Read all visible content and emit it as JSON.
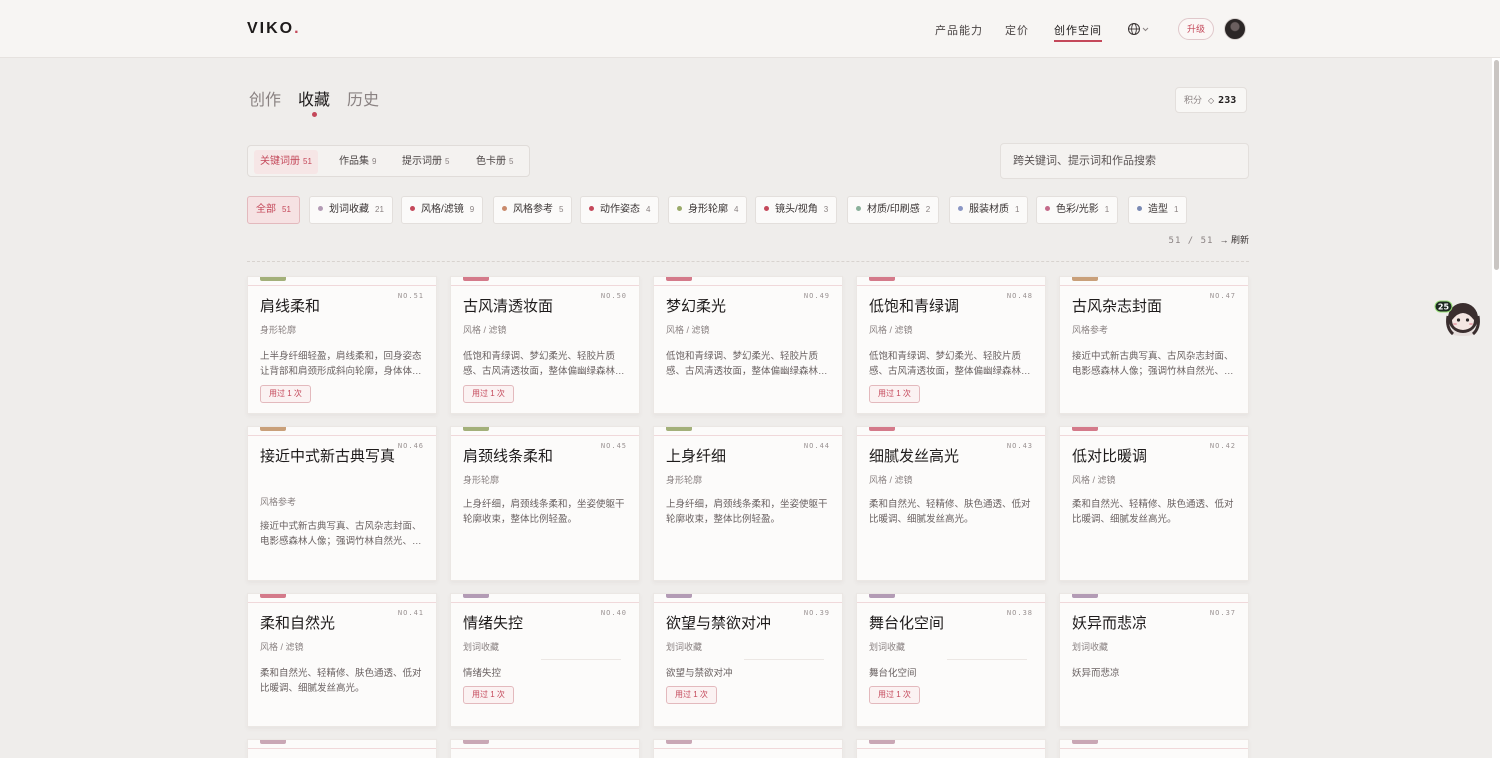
{
  "brand": {
    "name": "VIKO",
    "dot": "."
  },
  "nav": {
    "items": [
      "产品能力",
      "定价",
      "创作空间"
    ],
    "active_index": 2,
    "upgrade_label": "升级",
    "globe_icon": "globe-icon"
  },
  "main_tabs": {
    "items": [
      "创作",
      "收藏",
      "历史"
    ],
    "active_index": 1
  },
  "points": {
    "label": "积分",
    "value": "233"
  },
  "sub_tabs": [
    {
      "label": "关键词册",
      "count": "51",
      "active": true
    },
    {
      "label": "作品集",
      "count": "9",
      "active": false
    },
    {
      "label": "提示词册",
      "count": "5",
      "active": false
    },
    {
      "label": "色卡册",
      "count": "5",
      "active": false
    }
  ],
  "search": {
    "placeholder": "跨关键词、提示词和作品搜索"
  },
  "filters": [
    {
      "label": "全部",
      "count": "51",
      "color": "",
      "active": true
    },
    {
      "label": "划词收藏",
      "count": "21",
      "color": "#b39bb5",
      "active": false
    },
    {
      "label": "风格/滤镜",
      "count": "9",
      "color": "#c4485a",
      "active": false
    },
    {
      "label": "风格参考",
      "count": "5",
      "color": "#c98a6c",
      "active": false
    },
    {
      "label": "动作姿态",
      "count": "4",
      "color": "#c4485a",
      "active": false
    },
    {
      "label": "身形轮廓",
      "count": "4",
      "color": "#9aaa6a",
      "active": false
    },
    {
      "label": "镜头/视角",
      "count": "3",
      "color": "#c4485a",
      "active": false
    },
    {
      "label": "材质/印刷感",
      "count": "2",
      "color": "#8ab09a",
      "active": false
    },
    {
      "label": "服装材质",
      "count": "1",
      "color": "#8a96c4",
      "active": false
    },
    {
      "label": "色彩/光影",
      "count": "1",
      "color": "#c46a8a",
      "active": false
    },
    {
      "label": "造型",
      "count": "1",
      "color": "#7a8ab4",
      "active": false
    }
  ],
  "result_count": {
    "text": "51 / 51",
    "refresh_label": "→ 刷新"
  },
  "cards": [
    {
      "no": "NO.51",
      "title": "肩线柔和",
      "category": "身形轮廓",
      "desc": "上半身纤细轻盈，肩线柔和，回身姿态让背部和肩颈形成斜向轮廓，身体体…",
      "used": "用过 1 次",
      "tag_color": "#a3b07a"
    },
    {
      "no": "NO.50",
      "title": "古风清透妆面",
      "category": "风格 / 滤镜",
      "desc": "低饱和青绿调、梦幻柔光、轻胶片质感、古风清透妆面，整体偏幽绿森林…",
      "used": "用过 1 次",
      "tag_color": "#d47a8a"
    },
    {
      "no": "NO.49",
      "title": "梦幻柔光",
      "category": "风格 / 滤镜",
      "desc": "低饱和青绿调、梦幻柔光、轻胶片质感、古风清透妆面，整体偏幽绿森林…",
      "used": "",
      "tag_color": "#d47a8a"
    },
    {
      "no": "NO.48",
      "title": "低饱和青绿调",
      "category": "风格 / 滤镜",
      "desc": "低饱和青绿调、梦幻柔光、轻胶片质感、古风清透妆面，整体偏幽绿森林…",
      "used": "用过 1 次",
      "tag_color": "#d47a8a"
    },
    {
      "no": "NO.47",
      "title": "古风杂志封面",
      "category": "风格参考",
      "desc": "接近中式新古典写真、古风杂志封面、电影感森林人像；强调竹林自然光、…",
      "used": "",
      "tag_color": "#c9a07a"
    },
    {
      "no": "NO.46",
      "title": "接近中式新古典写真",
      "category": "风格参考",
      "desc": "接近中式新古典写真、古风杂志封面、电影感森林人像；强调竹林自然光、…",
      "used": "",
      "tag_color": "#c9a07a"
    },
    {
      "no": "NO.45",
      "title": "肩颈线条柔和",
      "category": "身形轮廓",
      "desc": "上身纤细，肩颈线条柔和，坐姿使躯干轮廓收束，整体比例轻盈。",
      "used": "",
      "tag_color": "#a3b07a"
    },
    {
      "no": "NO.44",
      "title": "上身纤细",
      "category": "身形轮廓",
      "desc": "上身纤细，肩颈线条柔和，坐姿使躯干轮廓收束，整体比例轻盈。",
      "used": "",
      "tag_color": "#a3b07a"
    },
    {
      "no": "NO.43",
      "title": "细腻发丝高光",
      "category": "风格 / 滤镜",
      "desc": "柔和自然光、轻精修、肤色通透、低对比暖调、细腻发丝高光。",
      "used": "",
      "tag_color": "#d47a8a"
    },
    {
      "no": "NO.42",
      "title": "低对比暖调",
      "category": "风格 / 滤镜",
      "desc": "柔和自然光、轻精修、肤色通透、低对比暖调、细腻发丝高光。",
      "used": "",
      "tag_color": "#d47a8a"
    },
    {
      "no": "NO.41",
      "title": "柔和自然光",
      "category": "风格 / 滤镜",
      "desc": "柔和自然光、轻精修、肤色通透、低对比暖调、细腻发丝高光。",
      "used": "",
      "tag_color": "#d47a8a"
    },
    {
      "no": "NO.40",
      "title": "情绪失控",
      "category": "划词收藏",
      "desc": "情绪失控",
      "used": "用过 1 次",
      "tag_color": "#b39bb5"
    },
    {
      "no": "NO.39",
      "title": "欲望与禁欲对冲",
      "category": "划词收藏",
      "desc": "欲望与禁欲对冲",
      "used": "用过 1 次",
      "tag_color": "#b39bb5"
    },
    {
      "no": "NO.38",
      "title": "舞台化空间",
      "category": "划词收藏",
      "desc": "舞台化空间",
      "used": "用过 1 次",
      "tag_color": "#b39bb5"
    },
    {
      "no": "NO.37",
      "title": "妖异而悲凉",
      "category": "划词收藏",
      "desc": "妖异而悲凉",
      "used": "",
      "tag_color": "#b39bb5"
    },
    {
      "no": "",
      "title": "",
      "category": "",
      "desc": "",
      "used": "",
      "tag_color": "#c9a7b5"
    },
    {
      "no": "",
      "title": "",
      "category": "",
      "desc": "",
      "used": "",
      "tag_color": "#c9a7b5"
    },
    {
      "no": "",
      "title": "",
      "category": "",
      "desc": "",
      "used": "",
      "tag_color": "#c9a7b5"
    },
    {
      "no": "",
      "title": "",
      "category": "",
      "desc": "",
      "used": "",
      "tag_color": "#c9a7b5"
    },
    {
      "no": "",
      "title": "",
      "category": "",
      "desc": "",
      "used": "",
      "tag_color": "#c9a7b5"
    }
  ],
  "floater": {
    "badge": "25",
    "icon": "assistant-avatar-icon"
  }
}
